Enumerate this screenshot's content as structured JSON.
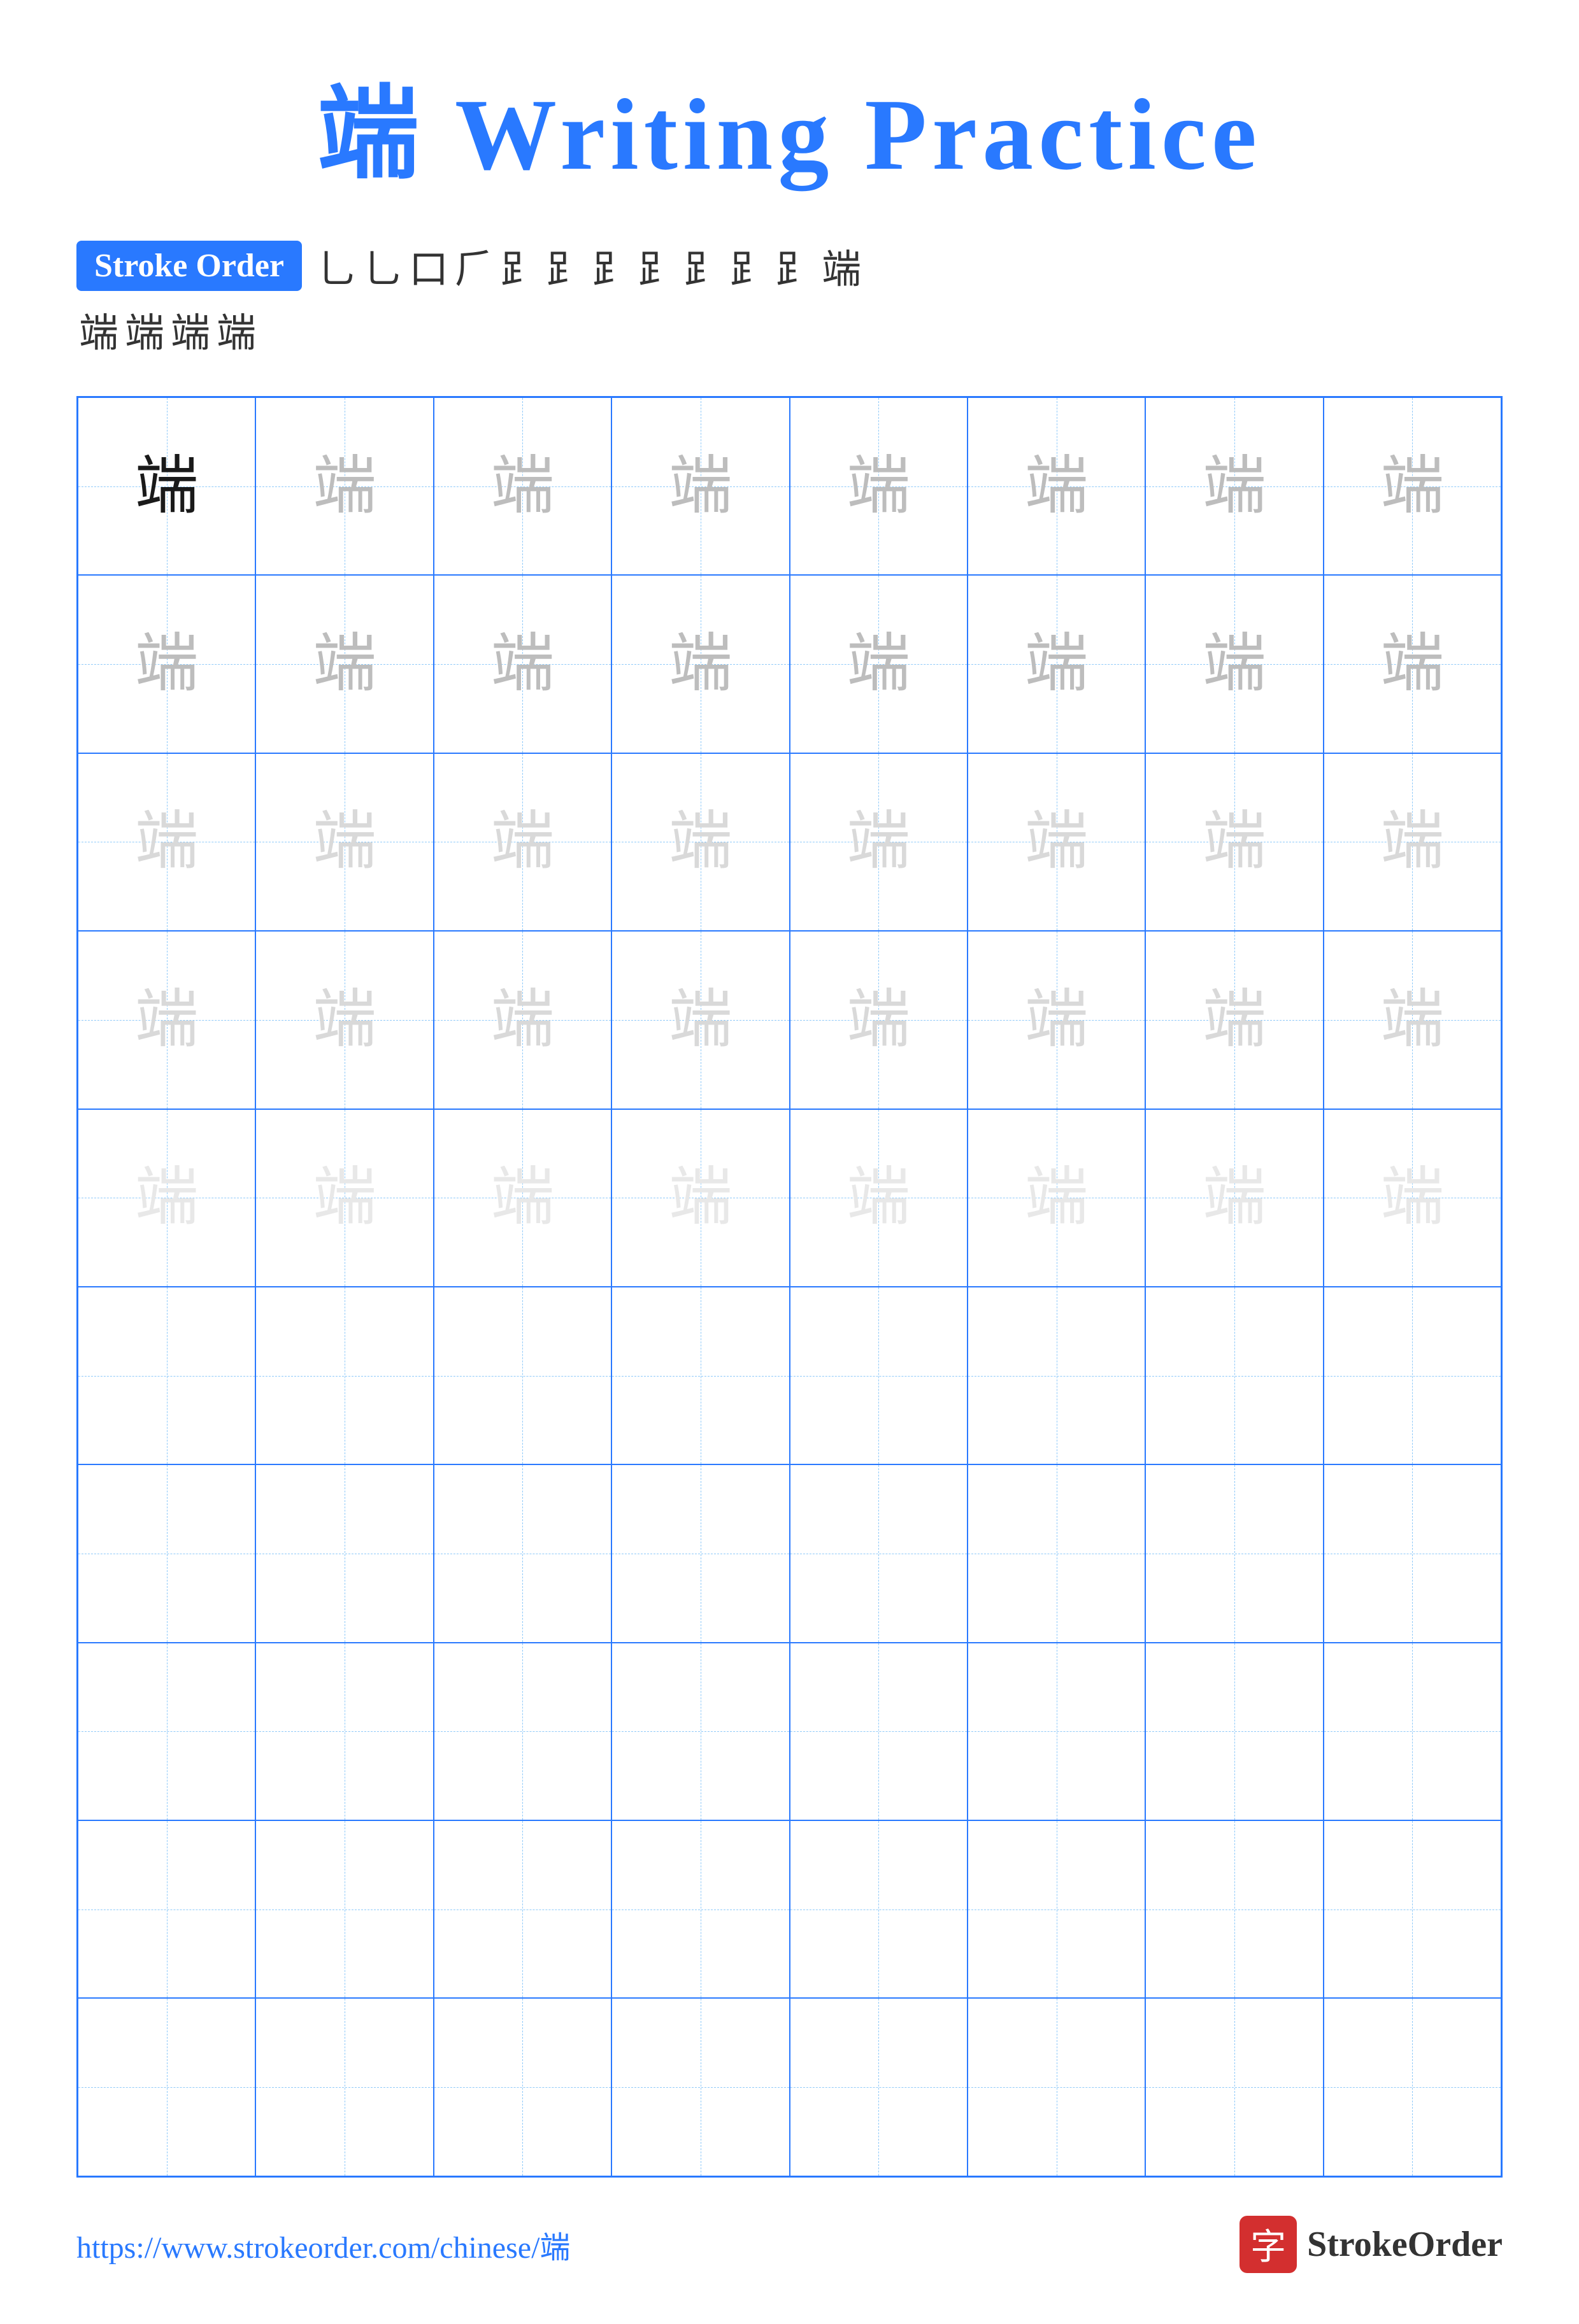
{
  "title": {
    "text": "端 Writing Practice",
    "char": "端"
  },
  "stroke_order": {
    "badge_label": "Stroke Order",
    "chars_row1": [
      "'",
      "⺃",
      "口",
      "⻊",
      "⻊",
      "⻊",
      "⻊",
      "⻊'",
      "⻊𠄌",
      "⻊𠄌",
      "𠄌⻊",
      "端"
    ],
    "chars_row2": [
      "端",
      "端",
      "端",
      "端"
    ]
  },
  "grid": {
    "cols": 8,
    "rows": 10,
    "char": "端",
    "row_styles": [
      [
        "dark",
        "medium",
        "medium",
        "medium",
        "medium",
        "medium",
        "medium",
        "medium"
      ],
      [
        "medium",
        "medium",
        "medium",
        "medium",
        "medium",
        "medium",
        "medium",
        "medium"
      ],
      [
        "light",
        "light",
        "light",
        "light",
        "light",
        "light",
        "light",
        "light"
      ],
      [
        "light",
        "light",
        "light",
        "light",
        "light",
        "light",
        "light",
        "light"
      ],
      [
        "very-light",
        "very-light",
        "very-light",
        "very-light",
        "very-light",
        "very-light",
        "very-light",
        "very-light"
      ],
      [
        "empty",
        "empty",
        "empty",
        "empty",
        "empty",
        "empty",
        "empty",
        "empty"
      ],
      [
        "empty",
        "empty",
        "empty",
        "empty",
        "empty",
        "empty",
        "empty",
        "empty"
      ],
      [
        "empty",
        "empty",
        "empty",
        "empty",
        "empty",
        "empty",
        "empty",
        "empty"
      ],
      [
        "empty",
        "empty",
        "empty",
        "empty",
        "empty",
        "empty",
        "empty",
        "empty"
      ],
      [
        "empty",
        "empty",
        "empty",
        "empty",
        "empty",
        "empty",
        "empty",
        "empty"
      ]
    ]
  },
  "footer": {
    "url": "https://www.strokeorder.com/chinese/端",
    "brand_icon": "字",
    "brand_name": "StrokeOrder"
  }
}
